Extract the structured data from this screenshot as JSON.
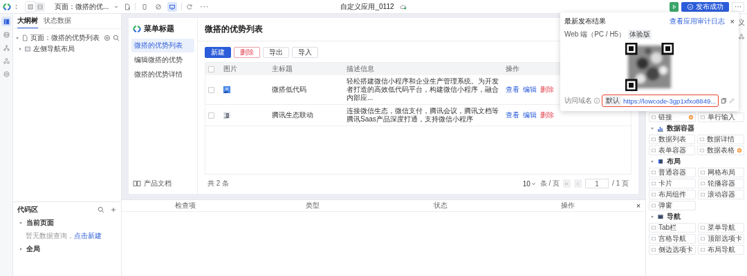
{
  "toolbar": {
    "view_modes": [
      {
        "kind": "outline",
        "selected": true
      },
      {
        "kind": "split",
        "selected": false
      }
    ],
    "page_select": "页面：微搭的优...",
    "devices": [
      {
        "kind": "phone",
        "selected": false
      },
      {
        "kind": "none",
        "selected": false
      },
      {
        "kind": "desktop",
        "selected": true
      }
    ],
    "more": "···",
    "app_title": "自定义应用_0112",
    "publish_button": "发布成功",
    "menu_button": "···"
  },
  "rail": [
    {
      "kind": "page",
      "selected": true
    },
    {
      "kind": "data",
      "selected": false
    },
    {
      "kind": "flow",
      "selected": false
    },
    {
      "kind": "components",
      "selected": false
    },
    {
      "kind": "settings",
      "selected": false
    }
  ],
  "outline": {
    "tabs": [
      {
        "label": "大纲树",
        "selected": true
      },
      {
        "label": "状态数据",
        "selected": false
      }
    ],
    "tree": [
      {
        "label": "页面：微搭的优势列表",
        "kind": "page",
        "expanded": true,
        "children": [
          {
            "label": "左侧导航布局",
            "kind": "layout",
            "expanded": false
          }
        ]
      }
    ]
  },
  "code_area": {
    "title": "代码区",
    "sections": [
      {
        "label": "当前页面",
        "expanded": true,
        "empty_text": "暂无数据查询，",
        "link": "点击新建"
      },
      {
        "label": "全局",
        "expanded": false
      }
    ]
  },
  "app_menu": {
    "title": "菜单标题",
    "items": [
      {
        "label": "微搭的优势列表",
        "selected": true
      },
      {
        "label": "编辑微搭的优势",
        "selected": false
      },
      {
        "label": "微搭的优势详情",
        "selected": false
      }
    ],
    "footer": "产品文档"
  },
  "page": {
    "title": "微搭的优势列表",
    "buttons": [
      {
        "label": "新建",
        "kind": "primary"
      },
      {
        "label": "删除",
        "kind": "danger"
      },
      {
        "label": "导出",
        "kind": "default"
      },
      {
        "label": "导入",
        "kind": "default"
      }
    ],
    "table": {
      "header_checked": false,
      "columns": [
        "图片",
        "主标题",
        "描述信息",
        "操作"
      ],
      "rows": [
        {
          "checked": false,
          "title": "微搭低代码",
          "description": "轻松搭建微信小程序和企业生产管理系统。为开发者打造的高效低代码平台，构建微信小程序，融合内部应...",
          "actions": [
            {
              "label": "查看",
              "kind": "link"
            },
            {
              "label": "编辑",
              "kind": "link"
            },
            {
              "label": "删除",
              "kind": "danger"
            }
          ]
        },
        {
          "checked": false,
          "title": "腾讯生态联动",
          "description": "连接微信生态，微信支付，腾讯会议，腾讯文档等腾讯Saas产品深度打通，支持微信小程序",
          "actions": [
            {
              "label": "查看",
              "kind": "link"
            },
            {
              "label": "编辑",
              "kind": "link"
            },
            {
              "label": "删除",
              "kind": "danger"
            }
          ]
        }
      ]
    },
    "pagination": {
      "total": "共 2 条",
      "page_size": "10",
      "per_page": "条 / 页",
      "page": "1",
      "pages": "/ 1 页"
    }
  },
  "checks_panel": {
    "columns": [
      "检查项",
      "类型",
      "状态",
      "操作"
    ],
    "close": "×"
  },
  "publish_popup": {
    "title": "最新发布结果",
    "audit_link": "查看应用审计日志",
    "close": "×",
    "platform": "Web 端（PC / H5）",
    "tag": "体验版",
    "domain_label": "访问域名",
    "domain_tag": "默认",
    "url": "https://lowcode-3gp1xfxo8849...",
    "highlighted": true
  },
  "component_panel": {
    "tab": "义",
    "groups": [
      {
        "items": [
          {
            "label": "链接",
            "badge": true
          },
          {
            "label": "单行输入",
            "badge": false
          }
        ]
      },
      {
        "label": "数据容器",
        "kind": "chart",
        "expanded": true,
        "items": [
          {
            "label": "数据列表",
            "badge": false
          },
          {
            "label": "数据详情",
            "badge": false
          },
          {
            "label": "表单容器",
            "badge": false
          },
          {
            "label": "数据表格",
            "badge": true
          }
        ]
      },
      {
        "label": "布局",
        "kind": "layout",
        "expanded": true,
        "items": [
          {
            "label": "普通容器",
            "badge": false
          },
          {
            "label": "网格布局",
            "badge": false
          },
          {
            "label": "卡片",
            "badge": false
          },
          {
            "label": "轮播容器",
            "badge": false
          },
          {
            "label": "布局组件",
            "badge": false
          },
          {
            "label": "滚动容器",
            "badge": false
          },
          {
            "label": "弹窗",
            "badge": false
          }
        ]
      },
      {
        "label": "导航",
        "kind": "nav",
        "expanded": true,
        "items": [
          {
            "label": "Tab栏",
            "badge": false
          },
          {
            "label": "菜单导航",
            "badge": false
          },
          {
            "label": "宫格导航",
            "badge": false
          },
          {
            "label": "顶部选项卡",
            "badge": false
          },
          {
            "label": "侧边选项卡",
            "badge": false
          },
          {
            "label": "布局导航",
            "badge": false
          }
        ]
      }
    ]
  }
}
